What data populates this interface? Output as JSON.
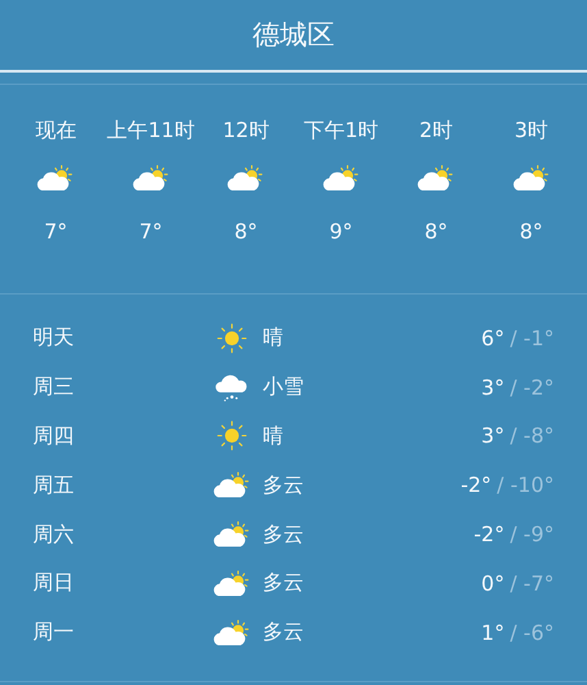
{
  "title": "德城区",
  "hourly": [
    {
      "time": "现在",
      "kind": "cloudy",
      "temp": "7°"
    },
    {
      "time": "上午11时",
      "kind": "cloudy",
      "temp": "7°"
    },
    {
      "time": "12时",
      "kind": "cloudy",
      "temp": "8°"
    },
    {
      "time": "下午1时",
      "kind": "cloudy",
      "temp": "9°"
    },
    {
      "time": "2时",
      "kind": "cloudy",
      "temp": "8°"
    },
    {
      "time": "3时",
      "kind": "cloudy",
      "temp": "8°"
    }
  ],
  "daily": [
    {
      "day": "明天",
      "kind": "sunny",
      "condition": "晴",
      "high": "6°",
      "low": "/ -1°"
    },
    {
      "day": "周三",
      "kind": "snow",
      "condition": "小雪",
      "high": "3°",
      "low": "/ -2°"
    },
    {
      "day": "周四",
      "kind": "sunny",
      "condition": "晴",
      "high": "3°",
      "low": "/ -8°"
    },
    {
      "day": "周五",
      "kind": "cloudy",
      "condition": "多云",
      "high": "-2°",
      "low": "/ -10°"
    },
    {
      "day": "周六",
      "kind": "cloudy",
      "condition": "多云",
      "high": "-2°",
      "low": "/ -9°"
    },
    {
      "day": "周日",
      "kind": "cloudy",
      "condition": "多云",
      "high": "0°",
      "low": "/ -7°"
    },
    {
      "day": "周一",
      "kind": "cloudy",
      "condition": "多云",
      "high": "1°",
      "low": "/ -6°"
    }
  ]
}
